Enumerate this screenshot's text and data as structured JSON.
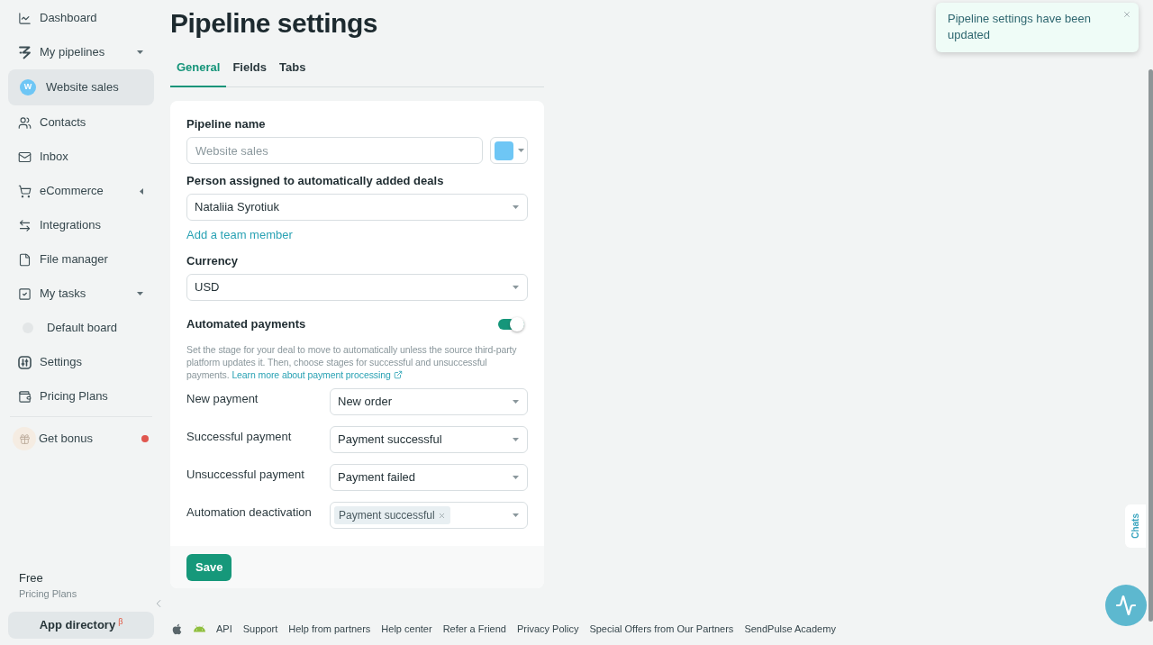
{
  "sidebar": {
    "items": [
      {
        "label": "Dashboard",
        "selected": false
      },
      {
        "label": "My pipelines",
        "selected": false,
        "expanded": true,
        "children": [
          {
            "label": "Website sales",
            "avatar": "W",
            "color": "#6ec6f5",
            "selected": true
          }
        ]
      },
      {
        "label": "Contacts",
        "selected": false
      },
      {
        "label": "Inbox",
        "selected": false
      },
      {
        "label": "eCommerce",
        "selected": false,
        "expanded": false
      },
      {
        "label": "Integrations",
        "selected": false
      },
      {
        "label": "File manager",
        "selected": false
      },
      {
        "label": "My tasks",
        "selected": false,
        "expanded": true,
        "children": [
          {
            "label": "Default board",
            "color": "#e3e6e7",
            "selected": false
          }
        ]
      },
      {
        "label": "Settings",
        "selected": false
      },
      {
        "label": "Pricing Plans",
        "selected": false
      }
    ],
    "bonus": {
      "label": "Get bonus",
      "unread": true
    },
    "plan": {
      "name": "Free",
      "link": "Pricing Plans"
    },
    "app_directory": {
      "label": "App directory",
      "badge": "β"
    }
  },
  "page": {
    "title": "Pipeline settings",
    "tabs": [
      {
        "label": "General",
        "selected": true
      },
      {
        "label": "Fields",
        "selected": false
      },
      {
        "label": "Tabs",
        "selected": false
      }
    ],
    "form": {
      "pipeline_name": {
        "label": "Pipeline name",
        "placeholder": "Website sales",
        "color": "#6ec6f5"
      },
      "assignee": {
        "label": "Person assigned to automatically added deals",
        "value": "Nataliia Syrotiuk",
        "link": "Add a team member"
      },
      "currency": {
        "label": "Currency",
        "value": "USD"
      },
      "automated_payments": {
        "label": "Automated payments",
        "on": true,
        "description": "Set the stage for your deal to move to automatically unless the source third-party platform updates it. Then, choose stages for successful and unsuccessful payments.",
        "link": "Learn more about payment processing",
        "rows": [
          {
            "kind": "select",
            "label": "New payment",
            "value": "New order"
          },
          {
            "kind": "select",
            "label": "Successful payment",
            "value": "Payment successful"
          },
          {
            "kind": "select",
            "label": "Unsuccessful payment",
            "value": "Payment failed"
          },
          {
            "kind": "tags",
            "label": "Automation deactivation",
            "tags": [
              "Payment successful"
            ]
          }
        ]
      },
      "save_button": "Save"
    }
  },
  "footer": {
    "links": [
      "API",
      "Support",
      "Help from partners",
      "Help center",
      "Refer a Friend",
      "Privacy Policy",
      "Special Offers from Our Partners",
      "SendPulse Academy"
    ]
  },
  "toast": {
    "message": "Pipeline settings have been updated"
  },
  "chats_tab": {
    "label": "Chats"
  }
}
